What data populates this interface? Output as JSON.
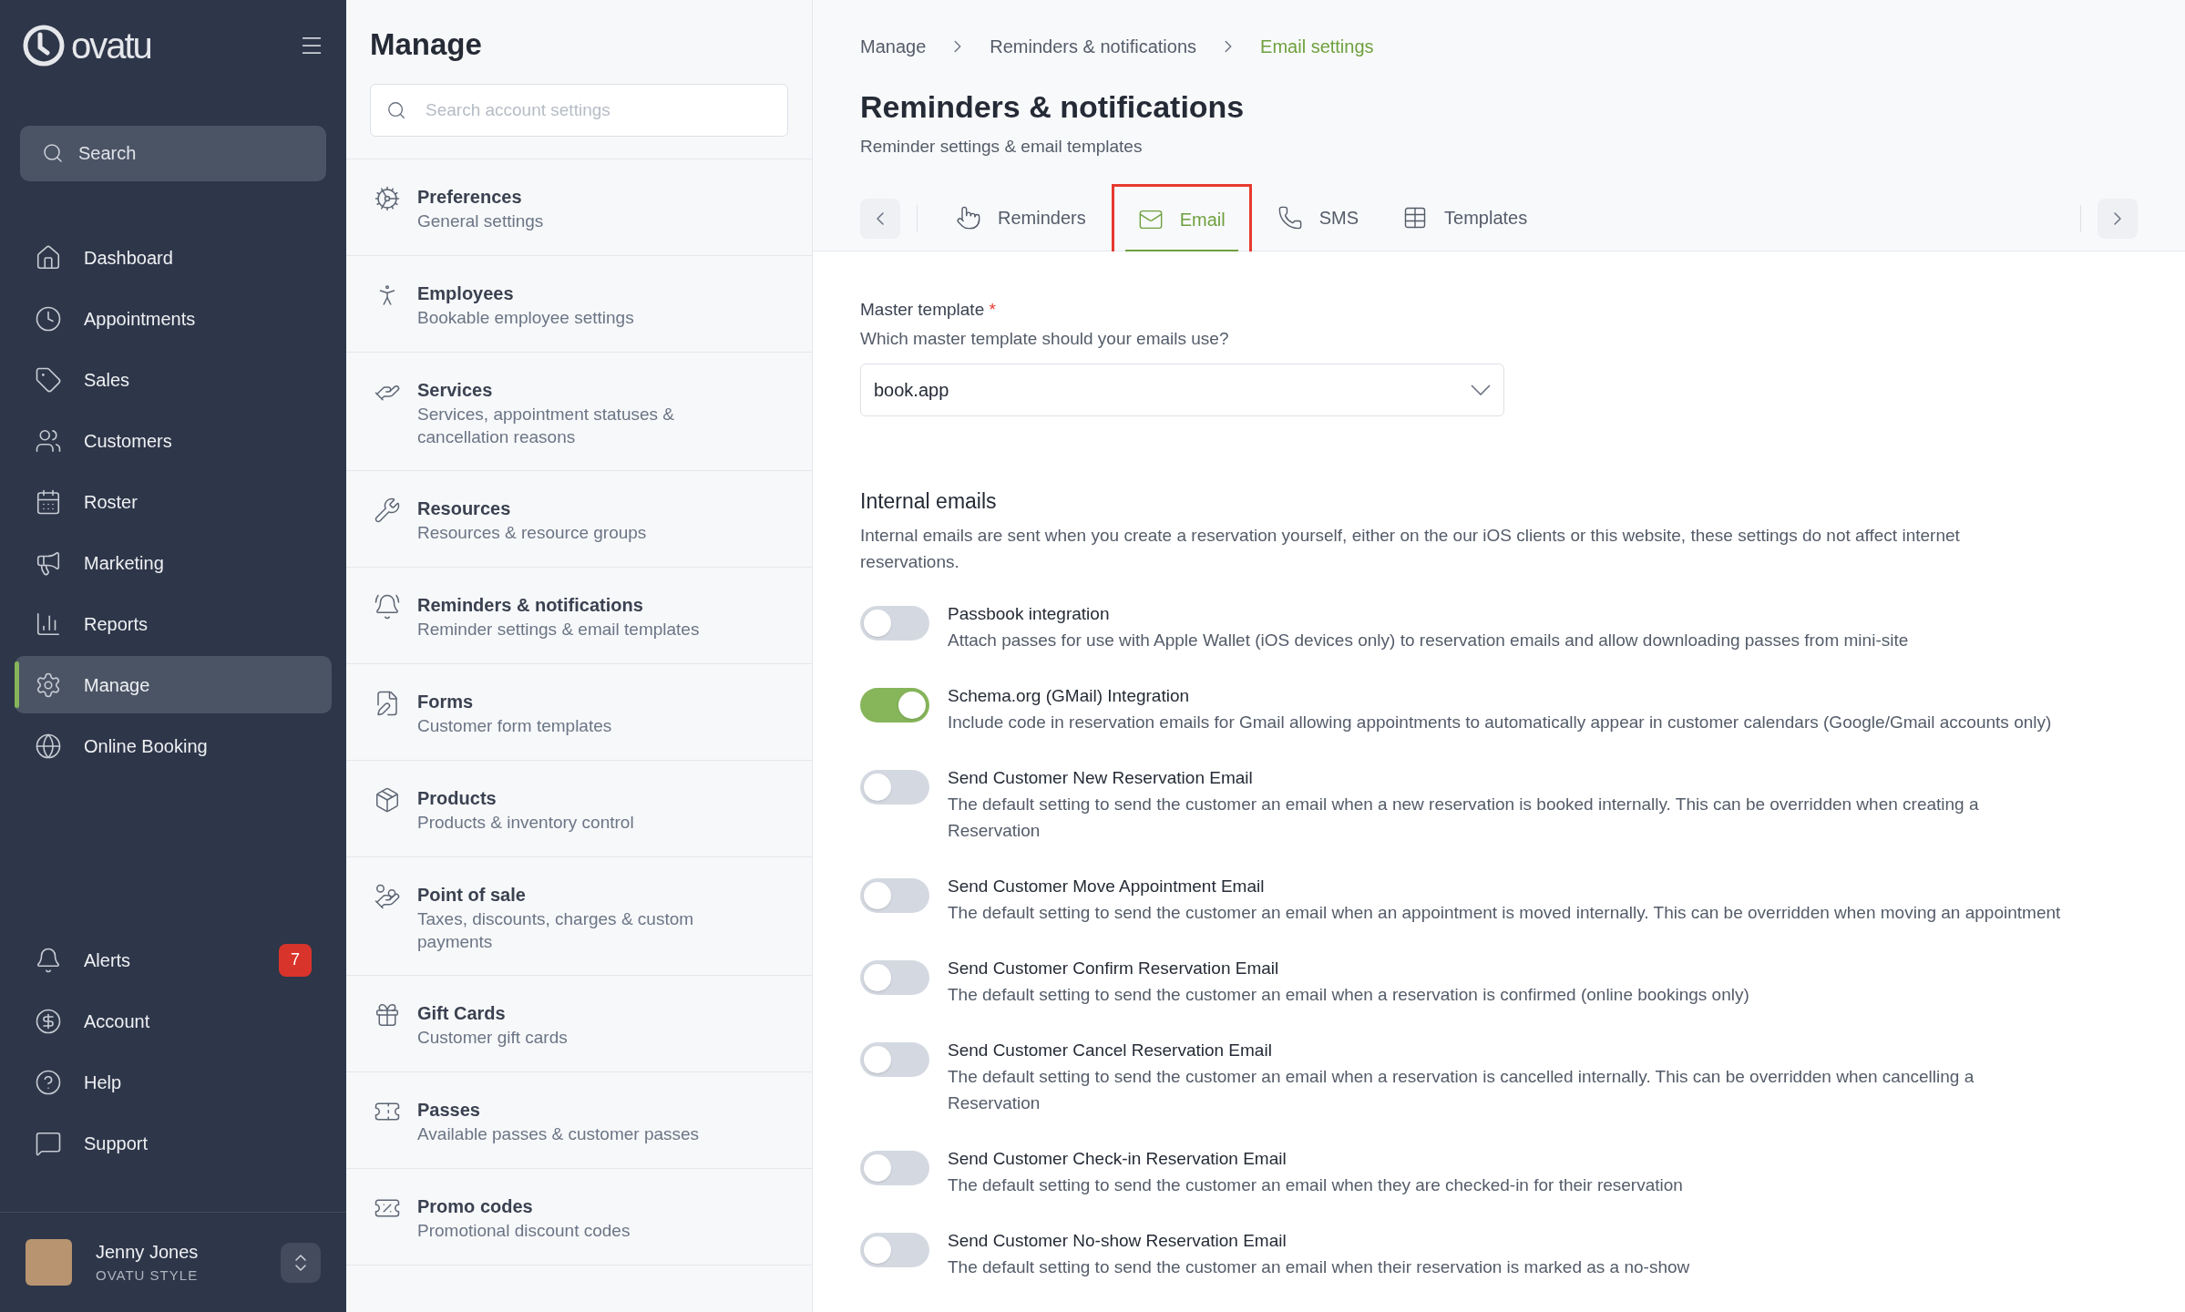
{
  "sidebar": {
    "logo": "ovatu",
    "search": {
      "placeholder": "Search"
    },
    "nav_items": [
      {
        "label": "Dashboard",
        "selected": false
      },
      {
        "label": "Appointments",
        "selected": false
      },
      {
        "label": "Sales",
        "selected": false
      },
      {
        "label": "Customers",
        "selected": false
      },
      {
        "label": "Roster",
        "selected": false
      },
      {
        "label": "Marketing",
        "selected": false
      },
      {
        "label": "Reports",
        "selected": false
      },
      {
        "label": "Manage",
        "selected": true
      },
      {
        "label": "Online Booking",
        "selected": false
      }
    ],
    "bottom_items": [
      {
        "label": "Alerts",
        "badge": "7"
      },
      {
        "label": "Account"
      },
      {
        "label": "Help"
      },
      {
        "label": "Support"
      }
    ],
    "user": {
      "name": "Jenny Jones",
      "org": "OVATU STYLE"
    }
  },
  "manage": {
    "title": "Manage",
    "search": {
      "placeholder": "Search account settings"
    },
    "items": [
      {
        "title": "Preferences",
        "subtitle": "General settings"
      },
      {
        "title": "Employees",
        "subtitle": "Bookable employee settings"
      },
      {
        "title": "Services",
        "subtitle": "Services, appointment statuses & cancellation reasons"
      },
      {
        "title": "Resources",
        "subtitle": "Resources & resource groups"
      },
      {
        "title": "Reminders & notifications",
        "subtitle": "Reminder settings & email templates"
      },
      {
        "title": "Forms",
        "subtitle": "Customer form templates"
      },
      {
        "title": "Products",
        "subtitle": "Products & inventory control"
      },
      {
        "title": "Point of sale",
        "subtitle": "Taxes, discounts, charges & custom payments"
      },
      {
        "title": "Gift Cards",
        "subtitle": "Customer gift cards"
      },
      {
        "title": "Passes",
        "subtitle": "Available passes & customer passes"
      },
      {
        "title": "Promo codes",
        "subtitle": "Promotional discount codes"
      }
    ]
  },
  "content": {
    "breadcrumb": [
      "Manage",
      "Reminders & notifications",
      "Email settings"
    ],
    "title": "Reminders & notifications",
    "subtitle": "Reminder settings & email templates",
    "tabs": [
      {
        "label": "Reminders",
        "selected": false,
        "highlighted": false
      },
      {
        "label": "Email",
        "selected": true,
        "highlighted": true
      },
      {
        "label": "SMS",
        "selected": false,
        "highlighted": false
      },
      {
        "label": "Templates",
        "selected": false,
        "highlighted": false
      }
    ],
    "master_template": {
      "label": "Master template",
      "required_mark": "*",
      "hint": "Which master template should your emails use?",
      "value": "book.app"
    },
    "internal": {
      "title": "Internal emails",
      "description": "Internal emails are sent when you create a reservation yourself, either on the our iOS clients or this website, these settings do not affect internet reservations."
    },
    "settings": [
      {
        "title": "Passbook integration",
        "description": "Attach passes for use with Apple Wallet (iOS devices only) to reservation emails and allow downloading passes from mini-site",
        "on": false
      },
      {
        "title": "Schema.org (GMail) Integration",
        "description": "Include code in reservation emails for Gmail allowing appointments to automatically appear in customer calendars (Google/Gmail accounts only)",
        "on": true
      },
      {
        "title": "Send Customer New Reservation Email",
        "description": "The default setting to send the customer an email when a new reservation is booked internally. This can be overridden when creating a Reservation",
        "on": false
      },
      {
        "title": "Send Customer Move Appointment Email",
        "description": "The default setting to send the customer an email when an appointment is moved internally. This can be overridden when moving an appointment",
        "on": false
      },
      {
        "title": "Send Customer Confirm Reservation Email",
        "description": "The default setting to send the customer an email when a reservation is confirmed (online bookings only)",
        "on": false
      },
      {
        "title": "Send Customer Cancel Reservation Email",
        "description": "The default setting to send the customer an email when a reservation is cancelled internally. This can be overridden when cancelling a Reservation",
        "on": false
      },
      {
        "title": "Send Customer Check-in Reservation Email",
        "description": "The default setting to send the customer an email when they are checked-in for their reservation",
        "on": false
      },
      {
        "title": "Send Customer No-show Reservation Email",
        "description": "The default setting to send the customer an email when their reservation is marked as a no-show",
        "on": false
      }
    ]
  }
}
